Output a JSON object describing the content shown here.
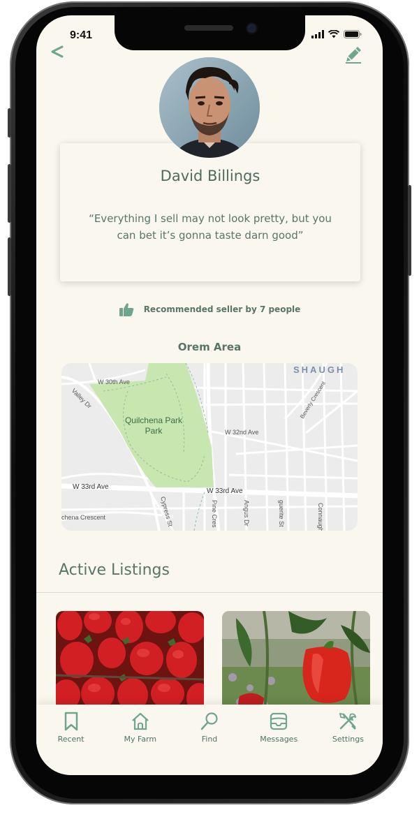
{
  "status_bar": {
    "time": "9:41"
  },
  "profile": {
    "name": "David Billings",
    "quote": "“Everything I sell may not look pretty, but you can bet it’s gonna taste darn good”",
    "recommendation": "Recommended seller by 7 people"
  },
  "location": {
    "area_title": "Orem Area",
    "map_labels": {
      "park": "Quilchena Park",
      "neighborhood": "SHAUGH",
      "streets": [
        "W 30th Ave",
        "Valley Dr",
        "W 32nd Ave",
        "W 33rd Ave",
        "W 33rd Ave",
        "Beverly Crescent",
        "Cypress St",
        "Pine Cres",
        "Angus Dr",
        "guerite St",
        "Connaugh",
        "chena Crescent"
      ]
    }
  },
  "listings": {
    "title": "Active Listings",
    "items": [
      "strawberries",
      "red bell pepper"
    ]
  },
  "tabs": [
    {
      "label": "Recent",
      "icon": "bookmark-icon"
    },
    {
      "label": "My Farm",
      "icon": "home-icon"
    },
    {
      "label": "Find",
      "icon": "search-icon"
    },
    {
      "label": "Messages",
      "icon": "inbox-icon"
    },
    {
      "label": "Settings",
      "icon": "tools-icon"
    }
  ],
  "colors": {
    "accent": "#6fa58c",
    "text": "#5a7468",
    "background": "#faf8ee",
    "park": "#c8e6b0"
  }
}
